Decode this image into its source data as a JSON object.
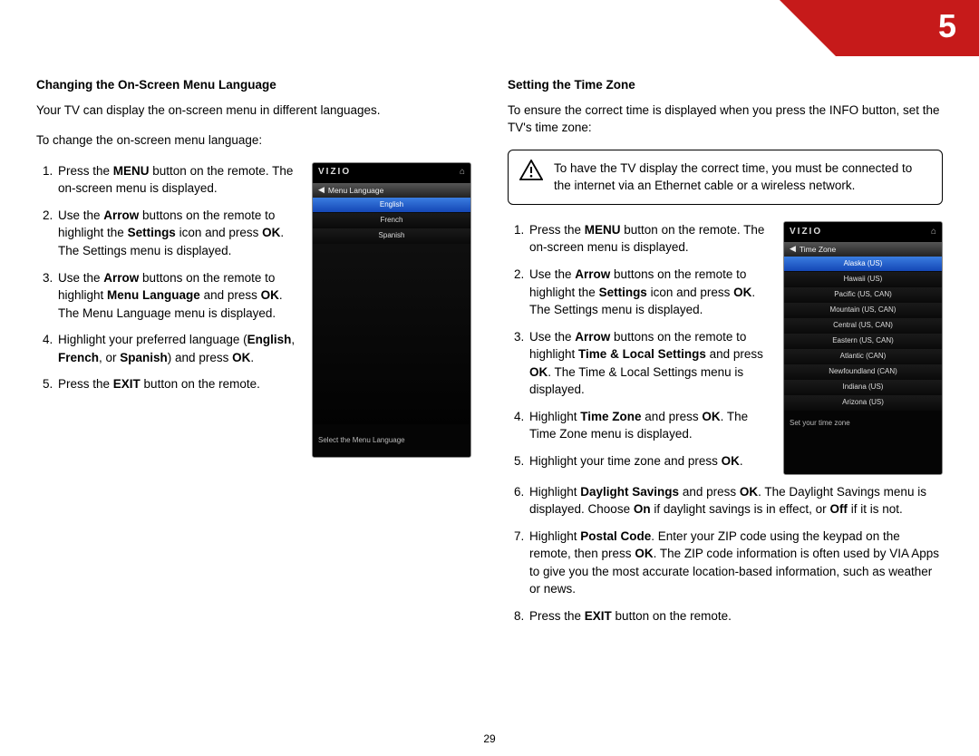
{
  "chapter_number": "5",
  "page_number": "29",
  "left": {
    "heading": "Changing the On-Screen Menu Language",
    "intro1": "Your TV can display the on-screen menu in different languages.",
    "intro2": "To change the on-screen menu language:",
    "steps": {
      "s1a": "Press the ",
      "s1b": "MENU",
      "s1c": " button on the remote. The on-screen menu is displayed.",
      "s2a": "Use the ",
      "s2b": "Arrow",
      "s2c": " buttons on the remote to highlight the ",
      "s2d": "Settings",
      "s2e": " icon and press ",
      "s2f": "OK",
      "s2g": ". The Settings menu is displayed.",
      "s3a": "Use the ",
      "s3b": "Arrow",
      "s3c": " buttons on the remote to highlight ",
      "s3d": "Menu Language",
      "s3e": " and press ",
      "s3f": "OK",
      "s3g": ". The Menu Language menu is displayed.",
      "s4a": "Highlight your preferred language (",
      "s4b": "English",
      "s4c": ", ",
      "s4d": "French",
      "s4e": ", or ",
      "s4f": "Spanish",
      "s4g": ") and press ",
      "s4h": "OK",
      "s4i": ".",
      "s5a": "Press the ",
      "s5b": "EXIT",
      "s5c": " button on the remote."
    },
    "tv": {
      "brand": "VIZIO",
      "header": "Menu Language",
      "items": [
        "English",
        "French",
        "Spanish"
      ],
      "selected": 0,
      "footer": "Select the Menu Language"
    }
  },
  "right": {
    "heading": "Setting the Time Zone",
    "intro": "To ensure the correct time is displayed when you press the INFO button, set the TV's time zone:",
    "warning": "To have the TV display the correct time, you must be connected to the internet via an Ethernet cable or a wireless network.",
    "steps": {
      "s1a": "Press the ",
      "s1b": "MENU",
      "s1c": " button on the remote. The on-screen menu is displayed.",
      "s2a": "Use the ",
      "s2b": "Arrow",
      "s2c": " buttons on the remote to highlight the ",
      "s2d": "Settings",
      "s2e": " icon and press ",
      "s2f": "OK",
      "s2g": ". The Settings menu is displayed.",
      "s3a": "Use the ",
      "s3b": "Arrow",
      "s3c": " buttons on the remote to highlight ",
      "s3d": "Time & Local Settings",
      "s3e": " and press ",
      "s3f": "OK",
      "s3g": ". The Time & Local Settings menu is displayed.",
      "s4a": "Highlight ",
      "s4b": "Time Zone",
      "s4c": " and press ",
      "s4d": "OK",
      "s4e": ". The Time Zone menu is displayed.",
      "s5a": "Highlight your time zone and press ",
      "s5b": "OK",
      "s5c": ".",
      "s6a": "Highlight ",
      "s6b": "Daylight Savings",
      "s6c": " and press ",
      "s6d": "OK",
      "s6e": ". The Daylight Savings menu is displayed. Choose ",
      "s6f": "On",
      "s6g": " if daylight savings is in effect, or ",
      "s6h": "Off",
      "s6i": " if it is not.",
      "s7a": "Highlight ",
      "s7b": "Postal Code",
      "s7c": ". Enter your ZIP code using the keypad on the remote, then press ",
      "s7d": "OK",
      "s7e": ". The ZIP code information is often used by VIA Apps to give you the most accurate location-based information, such as weather or news.",
      "s8a": "Press the ",
      "s8b": "EXIT",
      "s8c": " button on the remote."
    },
    "tv": {
      "brand": "VIZIO",
      "header": "Time Zone",
      "items": [
        "Alaska (US)",
        "Hawaii (US)",
        "Pacific (US, CAN)",
        "Mountain (US, CAN)",
        "Central (US, CAN)",
        "Eastern (US, CAN)",
        "Atlantic (CAN)",
        "Newfoundland (CAN)",
        "Indiana (US)",
        "Arizona (US)"
      ],
      "selected": 0,
      "footer": "Set your time zone"
    }
  }
}
